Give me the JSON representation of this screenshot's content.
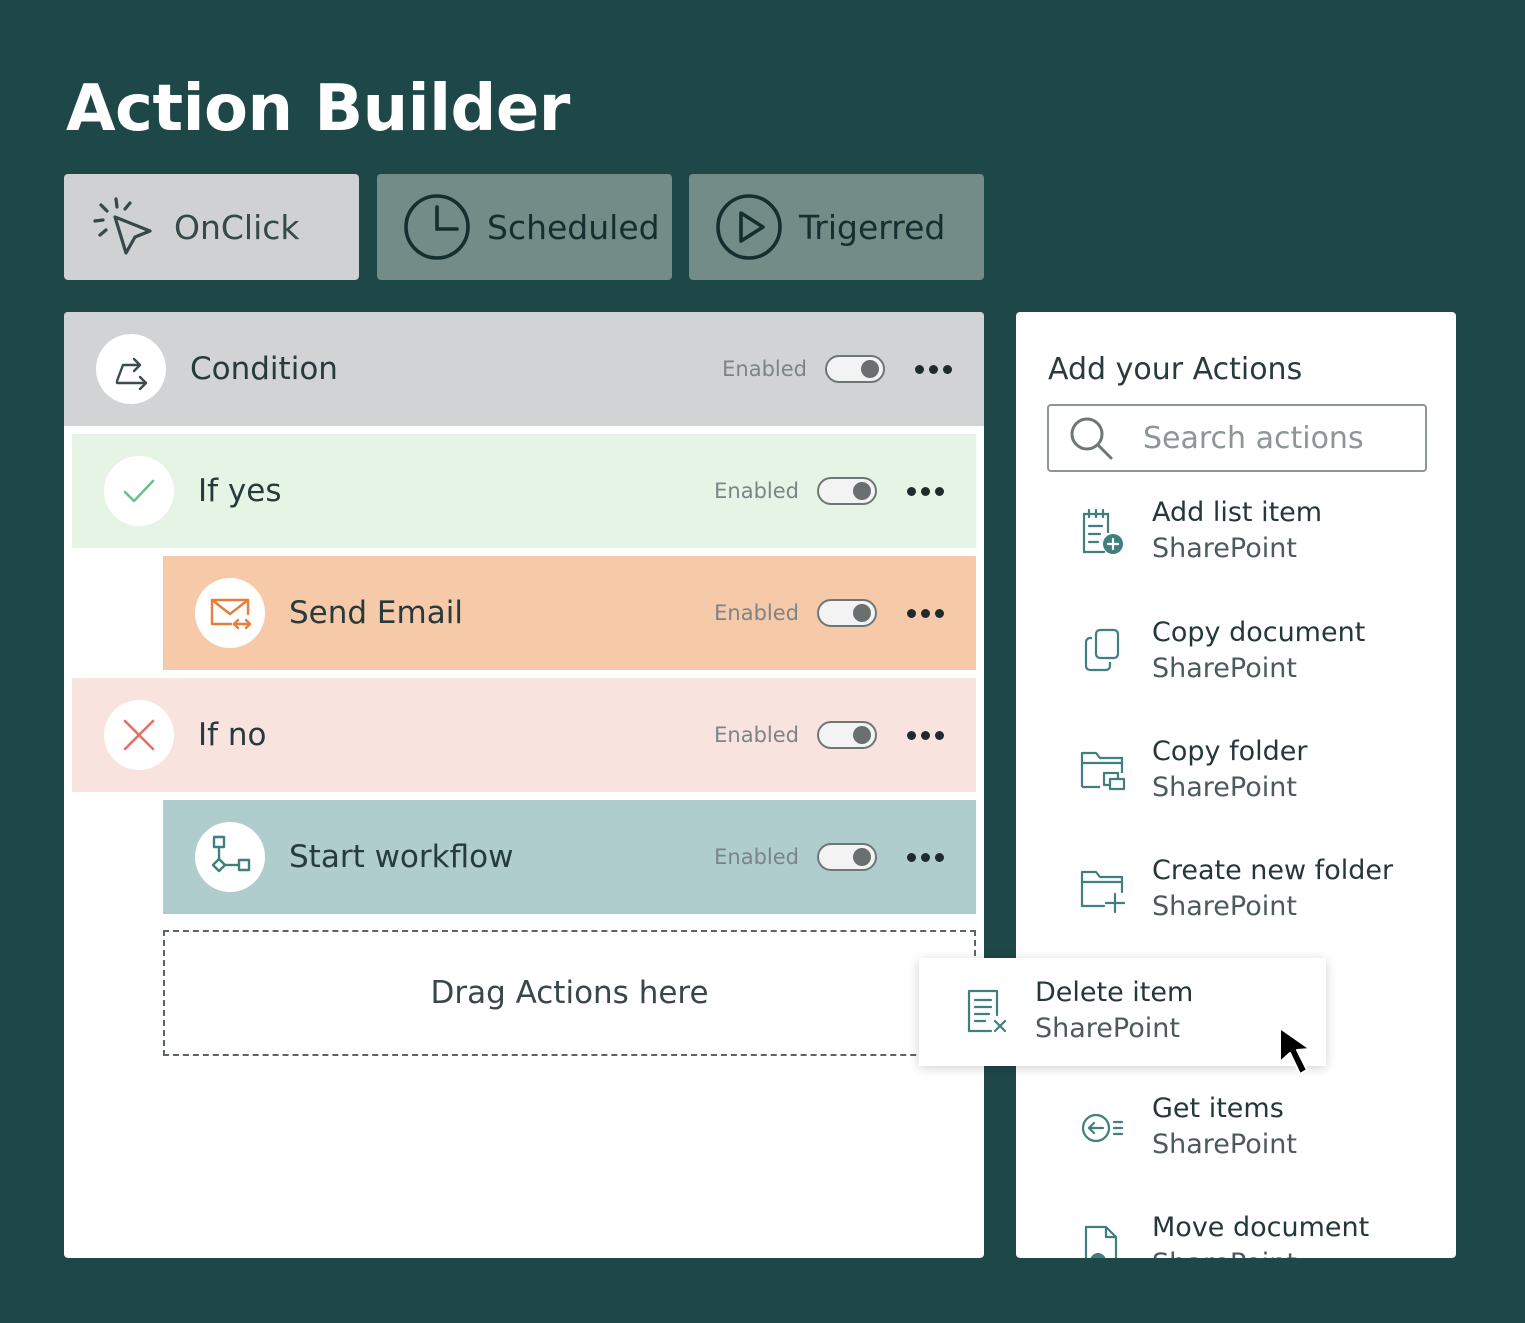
{
  "page": {
    "title": "Action Builder"
  },
  "triggers": [
    {
      "label": "OnClick",
      "icon": "pointer-click-icon",
      "active": true
    },
    {
      "label": "Scheduled",
      "icon": "clock-icon",
      "active": false
    },
    {
      "label": "Trigerred",
      "icon": "play-icon",
      "active": false
    }
  ],
  "builder": {
    "rows": [
      {
        "label": "Condition",
        "status": "Enabled",
        "icon": "branch-arrow-icon",
        "color": "#d1d3d5"
      },
      {
        "label": "If yes",
        "status": "Enabled",
        "icon": "check-icon",
        "color": "#e5f4e4"
      },
      {
        "label": "Send Email",
        "status": "Enabled",
        "icon": "email-icon",
        "color": "#f6c9a9"
      },
      {
        "label": "If no",
        "status": "Enabled",
        "icon": "close-icon",
        "color": "#f9e3df"
      },
      {
        "label": "Start workflow",
        "status": "Enabled",
        "icon": "workflow-icon",
        "color": "#afcdcc"
      }
    ],
    "dropzone": "Drag Actions here"
  },
  "actions_panel": {
    "title": "Add your Actions",
    "search_placeholder": "Search actions",
    "items": [
      {
        "name": "Add list item",
        "source": "SharePoint",
        "icon": "add-list-item-icon"
      },
      {
        "name": "Copy document",
        "source": "SharePoint",
        "icon": "copy-document-icon"
      },
      {
        "name": "Copy folder",
        "source": "SharePoint",
        "icon": "copy-folder-icon"
      },
      {
        "name": "Create new folder",
        "source": "SharePoint",
        "icon": "create-folder-icon"
      },
      {
        "name": "Get items",
        "source": "SharePoint",
        "icon": "get-items-icon"
      },
      {
        "name": "Move document",
        "source": "SharePoint",
        "icon": "move-document-icon"
      }
    ],
    "dragging": {
      "name": "Delete item",
      "source": "SharePoint",
      "icon": "delete-item-icon"
    }
  },
  "colors": {
    "background": "#1e4748",
    "icon_teal": "#3f7f7d",
    "icon_orange": "#e67e3c",
    "check_green": "#6cc28a",
    "close_red": "#e0736a"
  }
}
